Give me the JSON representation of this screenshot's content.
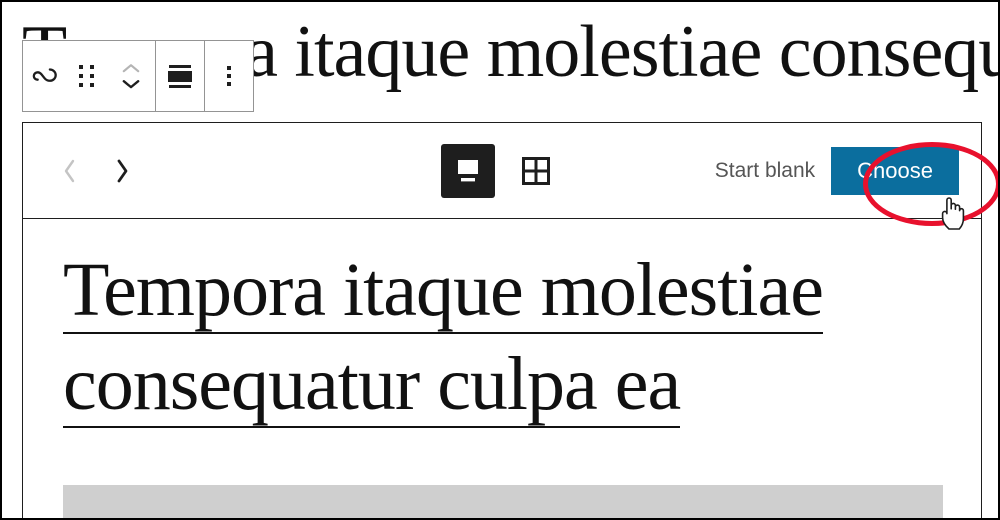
{
  "window": {
    "app": "WordPress Block Editor",
    "background_heading_text": "Tempora itaque molestiae consequatur culpa ea"
  },
  "block_toolbar": {
    "block_type_label": "Query Loop",
    "block_type_icon": "loop-icon",
    "drag_handle_icon": "drag-handle-icon",
    "move_up_icon": "chevron-up-icon",
    "move_up_label": "Move up",
    "move_up_disabled": "true",
    "move_down_icon": "chevron-down-icon",
    "move_down_label": "Move down",
    "align_icon": "align-wide-icon",
    "align_label": "Align",
    "more_icon": "more-options-icon",
    "more_label": "Options"
  },
  "pattern_picker": {
    "prev_icon": "chevron-left-icon",
    "prev_label": "Previous pattern",
    "prev_disabled": "true",
    "next_icon": "chevron-right-icon",
    "next_label": "Next pattern",
    "view_modes": [
      {
        "name": "single",
        "icon": "desktop-view-icon",
        "label": "Single view",
        "active": "true"
      },
      {
        "name": "grid",
        "icon": "grid-view-icon",
        "label": "Grid view",
        "active": "false"
      }
    ],
    "start_blank_label": "Start blank",
    "choose_label": "Choose",
    "choose_button_color": "#0b6e9e",
    "preview": {
      "heading": "Tempora itaque molestiae consequatur culpa ea",
      "placeholder_block_color": "#cfcfcf"
    }
  },
  "annotation": {
    "highlight_target": "choose-button",
    "highlight_shape": "ellipse",
    "highlight_color": "#e8112d",
    "cursor_icon": "pointing-hand-cursor",
    "cursor_x": "951",
    "cursor_y": "212"
  }
}
